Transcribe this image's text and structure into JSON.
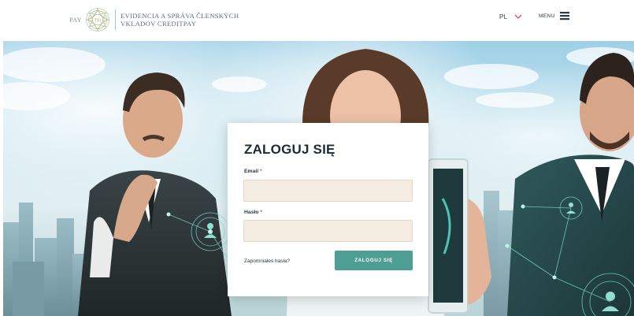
{
  "header": {
    "brand": {
      "prefix": "PAY",
      "emblem_text": "TD",
      "line1": "EVIDENCIA A SPRÁVA ČLENSKÝCH",
      "line2": "VKLADOV CREDITPAY"
    },
    "language": {
      "selected": "PL"
    },
    "menu_label": "MENU"
  },
  "login": {
    "title": "ZALOGUJ SIĘ",
    "email_label": "Email",
    "password_label": "Hasło",
    "required_mark": "*",
    "email_value": "",
    "password_value": "",
    "forgot_link": "Zapomniałeś hasła?",
    "submit_label": "ZALOGUJ SIĘ"
  },
  "colors": {
    "accent": "#4e9e93",
    "input_background": "#f5ede2",
    "required": "#e0454f",
    "header_text": "#5b6f86"
  },
  "icons": {
    "emblem": "pay-td-emblem",
    "language_dropdown": "chevron-down-icon",
    "menu": "hamburger-icon"
  }
}
